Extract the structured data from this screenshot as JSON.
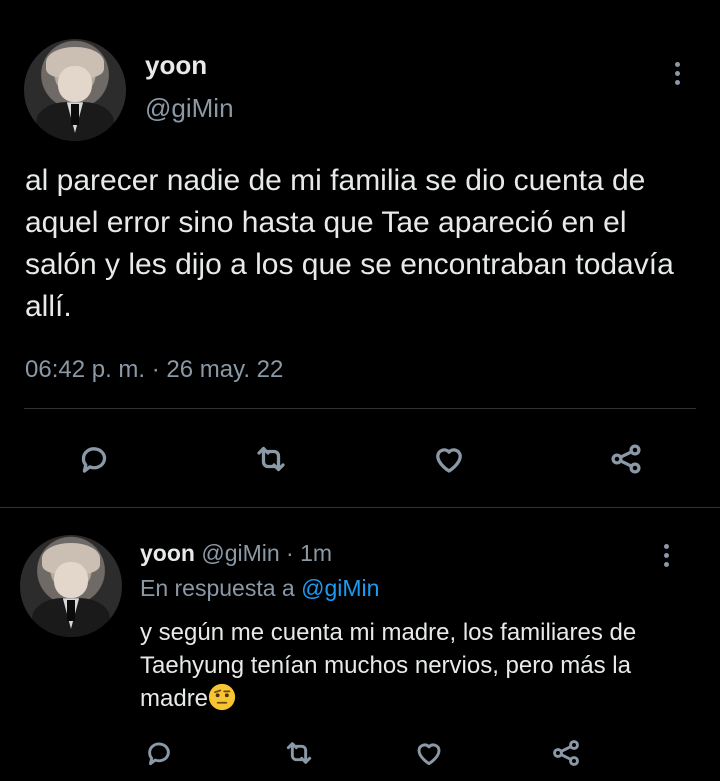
{
  "tweet": {
    "author_name": "yoon",
    "author_handle": "@giMin",
    "text": "al parecer nadie de mi familia se dio cuenta de aquel error sino hasta que Tae apareció en el salón y les dijo a los que se encontraban todavía allí.",
    "timestamp": "06:42 p. m. · 26 may. 22",
    "actions": [
      "reply-icon",
      "retweet-icon",
      "like-icon",
      "share-icon"
    ]
  },
  "reply": {
    "author_name": "yoon",
    "author_handle": "@giMin · 1m",
    "replying_to_prefix": "En respuesta a ",
    "replying_to_handle": "@giMin",
    "text": "y según me cuenta mi madre, los familiares de Taehyung tenían muchos nervios, pero más la madre",
    "emoji": "raised-eyebrow-emoji",
    "actions": [
      "reply-icon",
      "retweet-icon",
      "like-icon",
      "share-icon"
    ]
  },
  "colors": {
    "background": "#000000",
    "text": "#e7e9ea",
    "secondary": "#8b98a5",
    "accent": "#1d9bf0",
    "divider": "#2f3336"
  }
}
